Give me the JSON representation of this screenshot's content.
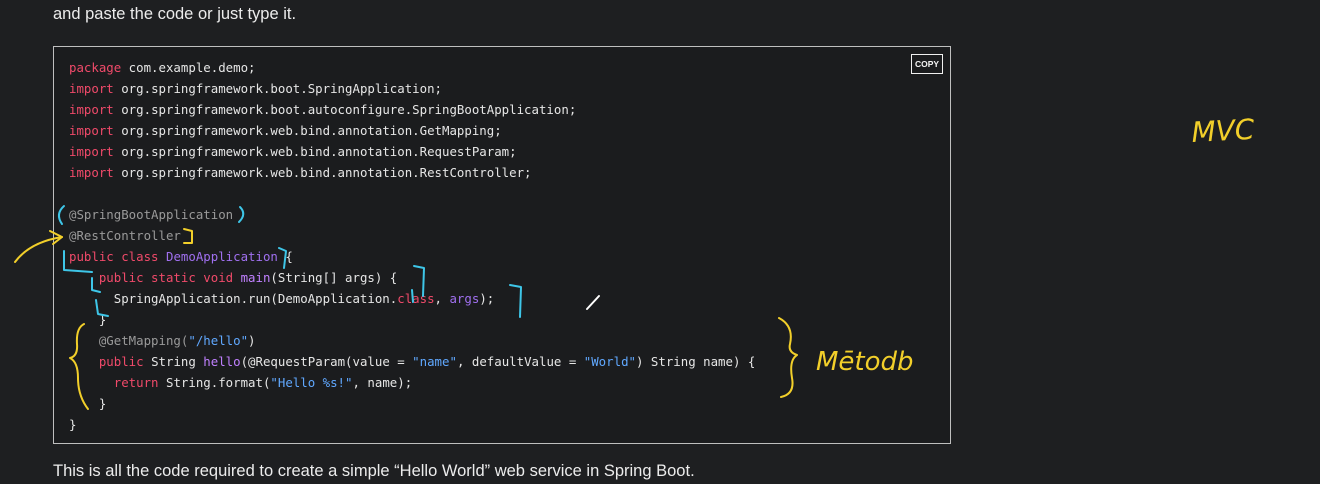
{
  "article": {
    "intro_text": "and paste the code or just type it.",
    "outro_text": "This is all the code required to create a simple “Hello World” web service in Spring Boot."
  },
  "code_block": {
    "copy_label": "COPY",
    "lines": [
      [
        {
          "t": "package",
          "c": "kw"
        },
        {
          "t": " com.example.demo;",
          "c": "plain"
        }
      ],
      [
        {
          "t": "import",
          "c": "kw"
        },
        {
          "t": " org.springframework.boot.SpringApplication;",
          "c": "plain"
        }
      ],
      [
        {
          "t": "import",
          "c": "kw"
        },
        {
          "t": " org.springframework.boot.autoconfigure.SpringBootApplication;",
          "c": "plain"
        }
      ],
      [
        {
          "t": "import",
          "c": "kw"
        },
        {
          "t": " org.springframework.web.bind.annotation.GetMapping;",
          "c": "plain"
        }
      ],
      [
        {
          "t": "import",
          "c": "kw"
        },
        {
          "t": " org.springframework.web.bind.annotation.RequestParam;",
          "c": "plain"
        }
      ],
      [
        {
          "t": "import",
          "c": "kw"
        },
        {
          "t": " org.springframework.web.bind.annotation.RestController;",
          "c": "plain"
        }
      ],
      [],
      [
        {
          "t": "@SpringBootApplication",
          "c": "ann"
        }
      ],
      [
        {
          "t": "@RestController",
          "c": "ann"
        }
      ],
      [
        {
          "t": "public class ",
          "c": "kw"
        },
        {
          "t": "DemoApplication",
          "c": "cls"
        },
        {
          "t": " {",
          "c": "plain"
        }
      ],
      [
        {
          "t": "    public static void ",
          "c": "kw"
        },
        {
          "t": "main",
          "c": "fn"
        },
        {
          "t": "(String[] args) {",
          "c": "plain"
        }
      ],
      [
        {
          "t": "      SpringApplication.run(DemoApplication.",
          "c": "plain"
        },
        {
          "t": "class",
          "c": "kw"
        },
        {
          "t": ", ",
          "c": "plain"
        },
        {
          "t": "args",
          "c": "cls"
        },
        {
          "t": ");",
          "c": "plain"
        }
      ],
      [
        {
          "t": "    }",
          "c": "plain"
        }
      ],
      [
        {
          "t": "    @GetMapping(",
          "c": "ann"
        },
        {
          "t": "\"/hello\"",
          "c": "str"
        },
        {
          "t": ")",
          "c": "plain"
        }
      ],
      [
        {
          "t": "    public ",
          "c": "kw"
        },
        {
          "t": "String ",
          "c": "plain"
        },
        {
          "t": "hello",
          "c": "fn"
        },
        {
          "t": "(@RequestParam(value = ",
          "c": "plain"
        },
        {
          "t": "\"name\"",
          "c": "str"
        },
        {
          "t": ", defaultValue = ",
          "c": "plain"
        },
        {
          "t": "\"World\"",
          "c": "str"
        },
        {
          "t": ") String name) {",
          "c": "plain"
        }
      ],
      [
        {
          "t": "      return ",
          "c": "kw"
        },
        {
          "t": "String.format(",
          "c": "plain"
        },
        {
          "t": "\"Hello %s!\"",
          "c": "str"
        },
        {
          "t": ", name);",
          "c": "plain"
        }
      ],
      [
        {
          "t": "    }",
          "c": "plain"
        }
      ],
      [
        {
          "t": "}",
          "c": "plain"
        }
      ]
    ]
  },
  "annotations": {
    "note_mvc": "MVC",
    "note_method": "Mētodb",
    "yellow_ink": "#f2cf2a",
    "cyan_ink": "#3ec6e8"
  },
  "colors": {
    "keyword": "#f04a6a",
    "annotation": "#9a9a9a",
    "class_name": "#a070f0",
    "string": "#60a8ff",
    "background": "#1e1f21"
  }
}
